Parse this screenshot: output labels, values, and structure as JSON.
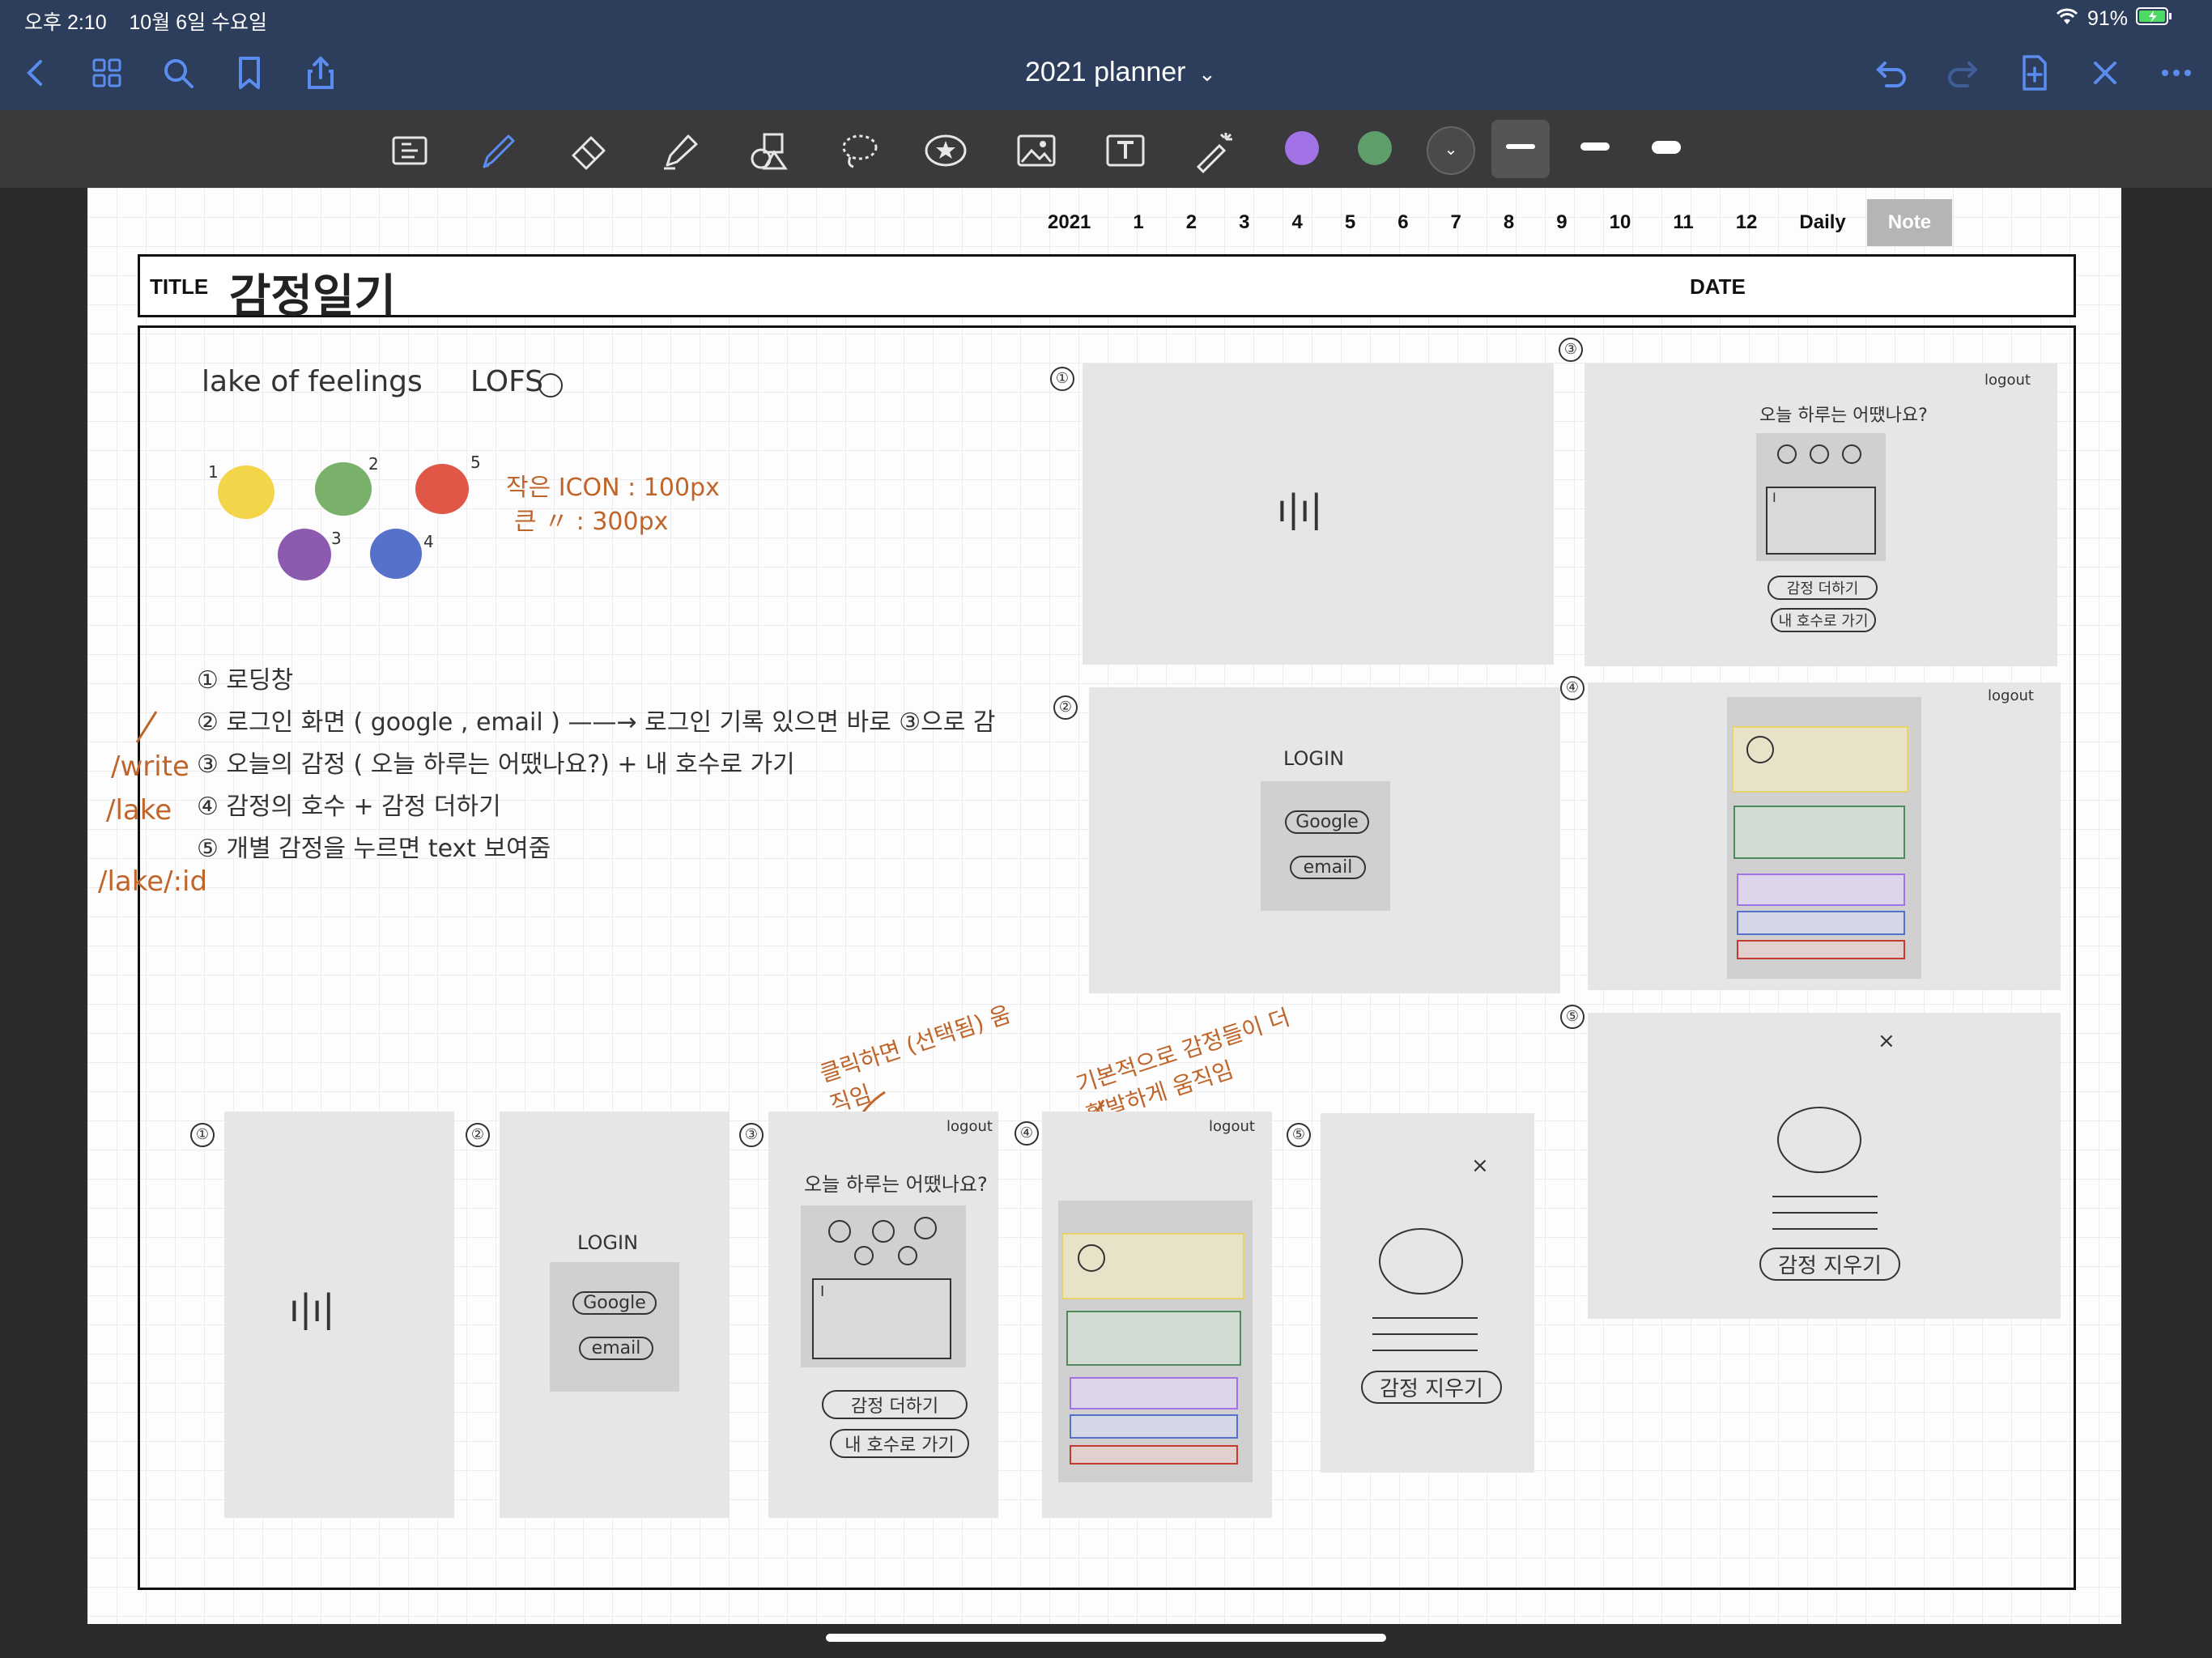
{
  "status": {
    "time": "오후 2:10",
    "date": "10월 6일 수요일",
    "battery": "91%"
  },
  "nav": {
    "title": "2021 planner",
    "title_chevron": "⌄"
  },
  "toolbar": {
    "tools": [
      "read-only-icon",
      "pen-icon",
      "eraser-icon",
      "highlighter-icon",
      "shapes-icon",
      "lasso-icon",
      "sticker-icon",
      "image-icon",
      "text-icon",
      "laser-icon"
    ],
    "colors": [
      "#a173e6",
      "#5e9e6a",
      "#4a4a4c"
    ]
  },
  "paper": {
    "tabs": [
      "2021",
      "1",
      "2",
      "3",
      "4",
      "5",
      "6",
      "7",
      "8",
      "9",
      "10",
      "11",
      "12",
      "Daily",
      "Note"
    ],
    "active_tab": "Note",
    "title_label": "TITLE",
    "title_value": "감정일기",
    "date_label": "DATE"
  },
  "notes": {
    "app_name": "lake of feelings",
    "app_abbr": "LOFS",
    "icon_size_small": "작은 ICON : 100px",
    "icon_size_big": "큰    〃 : 300px",
    "steps": [
      "① 로딩창",
      "② 로그인 화면 ( google , email )  ——→  로그인 기록 있으면 바로 ③으로 감",
      "③ 오늘의 감정 ( 오늘 하루는 어땠나요?) + 내 호수로 가기",
      "④ 감정의 호수   + 감정 더하기",
      "⑤ 개별 감정을 누르면 text 보여줌"
    ],
    "routes": [
      "/write",
      "/lake",
      "/lake/:id"
    ],
    "emoji_numbers": [
      "1",
      "2",
      "5",
      "3",
      "4"
    ],
    "annotation_click": "클릭하면 (선택됨) 움직임",
    "annotation_move": "기본적으로 감정들이 더 활발하게 움직임"
  },
  "wireframes": {
    "login": "LOGIN",
    "google": "Google",
    "email": "email",
    "logout": "logout",
    "question": "오늘 하루는 어땠나요?",
    "add_feeling": "감정 더하기",
    "go_lake": "내 호수로 가기",
    "delete_feeling": "감정 지우기",
    "close": "×",
    "cursor": "I",
    "loading": "ı|ı|",
    "labels": [
      "①",
      "②",
      "③",
      "④",
      "⑤"
    ]
  }
}
